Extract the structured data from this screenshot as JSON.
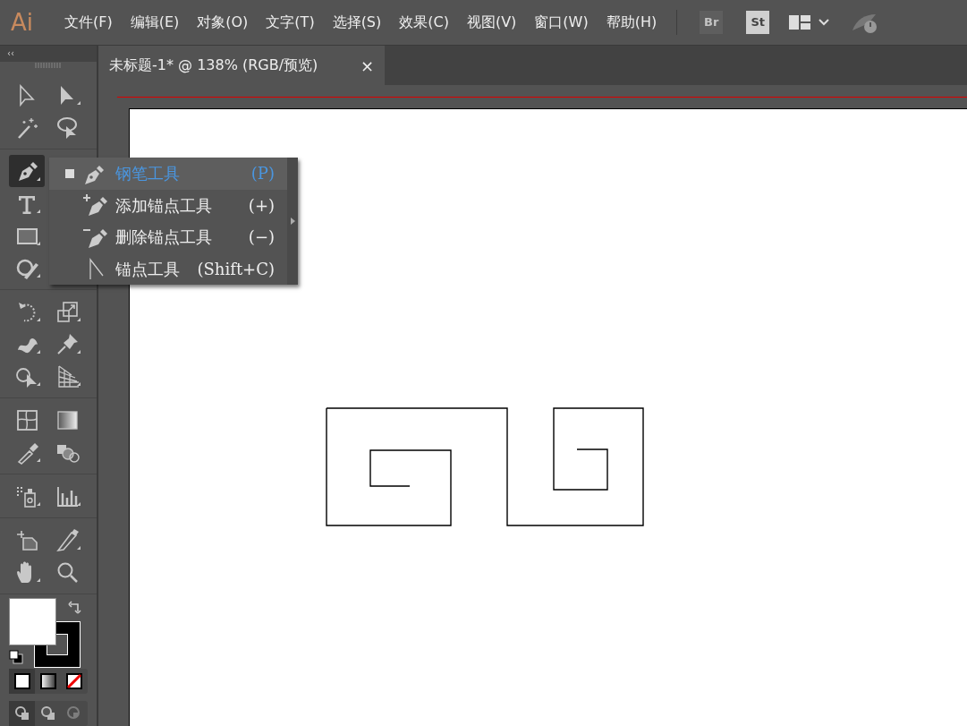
{
  "app": {
    "logo": "Ai"
  },
  "menu": [
    "文件(F)",
    "编辑(E)",
    "对象(O)",
    "文字(T)",
    "选择(S)",
    "效果(C)",
    "视图(V)",
    "窗口(W)",
    "帮助(H)"
  ],
  "app_buttons": [
    {
      "label": "Br"
    },
    {
      "label": "St"
    }
  ],
  "document_tab": {
    "title": "未标题-1* @ 138% (RGB/预览)",
    "close": "×"
  },
  "toolbar": {
    "collapse": "‹‹",
    "tool_groups": [
      [
        {
          "kind": "selection",
          "selected": false
        },
        {
          "kind": "direct",
          "selected": false
        },
        {
          "kind": "wand",
          "selected": false
        },
        {
          "kind": "lasso",
          "selected": false
        }
      ],
      [
        {
          "kind": "pen",
          "selected": true
        },
        {
          "kind": "none"
        },
        {
          "kind": "type",
          "selected": false
        },
        {
          "kind": "none"
        },
        {
          "kind": "rect",
          "selected": false
        },
        {
          "kind": "none"
        },
        {
          "kind": "shaper",
          "selected": false
        },
        {
          "kind": "none"
        }
      ],
      [
        {
          "kind": "rotate",
          "selected": false
        },
        {
          "kind": "scale",
          "selected": false
        },
        {
          "kind": "warp",
          "selected": false
        },
        {
          "kind": "pin",
          "selected": false
        },
        {
          "kind": "shapebuilder",
          "selected": false
        },
        {
          "kind": "perspective",
          "selected": false
        }
      ],
      [
        {
          "kind": "mesh",
          "selected": false
        },
        {
          "kind": "gradient",
          "selected": false
        },
        {
          "kind": "eyedropper",
          "selected": false
        },
        {
          "kind": "blend",
          "selected": false
        }
      ],
      [
        {
          "kind": "spray",
          "selected": false
        },
        {
          "kind": "graph",
          "selected": false
        }
      ],
      [
        {
          "kind": "artboard",
          "selected": false
        },
        {
          "kind": "slice",
          "selected": false
        },
        {
          "kind": "hand",
          "selected": false
        },
        {
          "kind": "zoom",
          "selected": false
        }
      ]
    ],
    "fill_modes": [
      {
        "kind": "color",
        "selected": true
      },
      {
        "kind": "gradient",
        "selected": false
      },
      {
        "kind": "none",
        "selected": false
      }
    ],
    "draw_modes": [
      {
        "kind": "normal",
        "selected": true
      },
      {
        "kind": "behind",
        "selected": false
      },
      {
        "kind": "inside",
        "selected": false,
        "disabled": true
      }
    ]
  },
  "flyout": {
    "items": [
      {
        "kind": "pen",
        "label": "钢笔工具",
        "shortcut": "(P)",
        "selected": true
      },
      {
        "kind": "add",
        "label": "添加锚点工具",
        "shortcut": "(+)",
        "selected": false
      },
      {
        "kind": "delete",
        "label": "删除锚点工具",
        "shortcut": "(−)",
        "selected": false
      },
      {
        "kind": "anchor",
        "label": "锚点工具",
        "shortcut": "(Shift+C)",
        "selected": false
      }
    ]
  }
}
